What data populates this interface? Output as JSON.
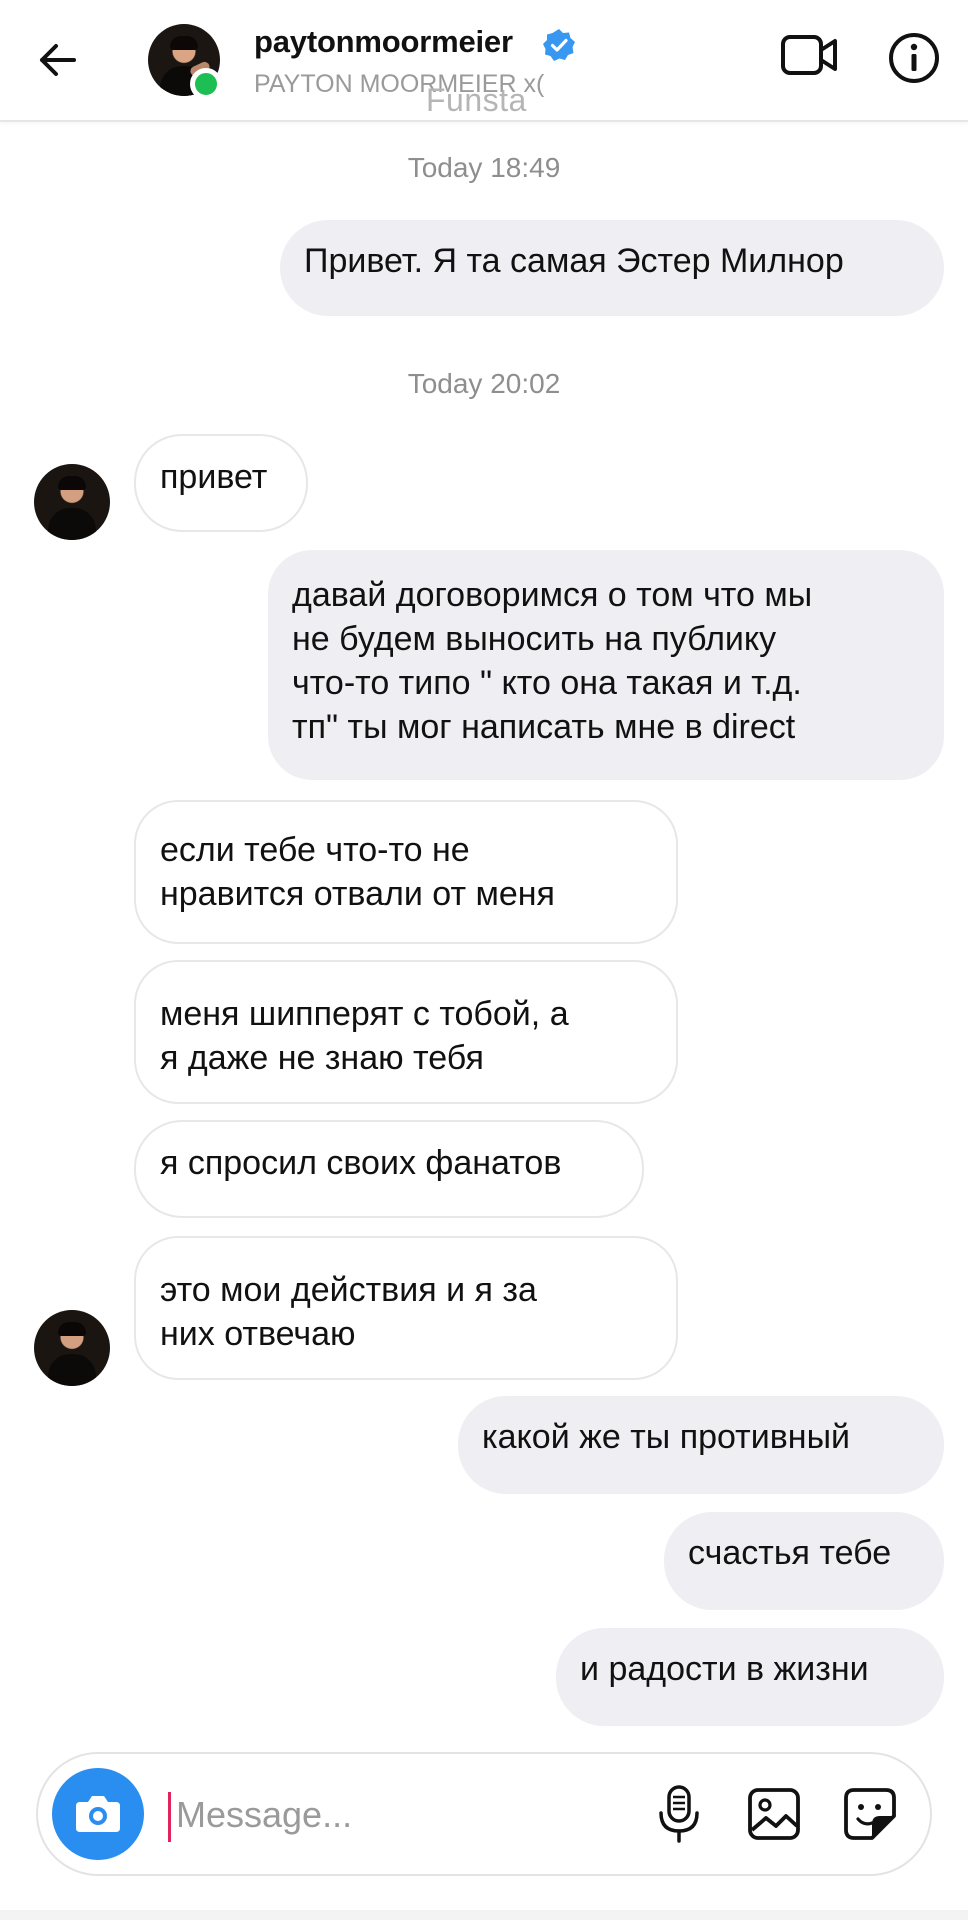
{
  "header": {
    "username": "paytonmoormeier",
    "fullname": "PAYTON MOORMEIER x(",
    "overlay": "Funsta",
    "verified": true,
    "online": true
  },
  "conversation": {
    "timestamps": [
      "Today 18:49",
      "Today 20:02"
    ],
    "messages": [
      {
        "from": "me",
        "text": "Привет. Я та самая Эстер Милнор"
      },
      {
        "from": "them",
        "text": "привет"
      },
      {
        "from": "me",
        "lines": [
          "давай договоримся  о том что мы",
          "не будем выносить на публику",
          "что-то типо \" кто она такая и т.д.",
          "тп\" ты мог написать мне в direct"
        ]
      },
      {
        "from": "them",
        "lines": [
          "если тебе что-то не",
          "нравится отвали от меня"
        ]
      },
      {
        "from": "them",
        "lines": [
          "меня шипперят с тобой, а",
          "я даже не знаю тебя"
        ]
      },
      {
        "from": "them",
        "text": "я спросил своих фанатов"
      },
      {
        "from": "them",
        "lines": [
          "это мои действия  и я за",
          "них отвечаю"
        ]
      },
      {
        "from": "me",
        "text": "какой же ты противный"
      },
      {
        "from": "me",
        "text": "счастья тебе"
      },
      {
        "from": "me",
        "text": "и радости в жизни"
      }
    ]
  },
  "composer": {
    "placeholder": "Message...",
    "value": ""
  },
  "icons": [
    "back-arrow-icon",
    "verified-badge-icon",
    "video-call-icon",
    "info-icon",
    "camera-icon",
    "microphone-icon",
    "gallery-icon",
    "sticker-icon"
  ],
  "colors": {
    "accent": "#2a8df0",
    "online": "#1dbf54",
    "outgoing_bubble": "#efeff3",
    "timestamp": "#8e8e8e"
  }
}
